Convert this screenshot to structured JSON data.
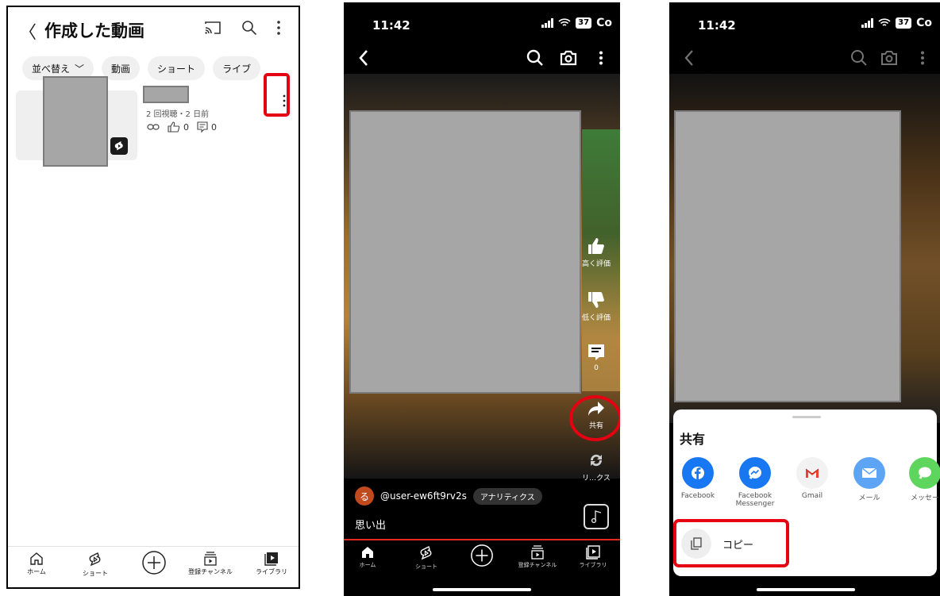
{
  "panel1": {
    "header": {
      "back": "〈",
      "title": "作成した動画"
    },
    "chips": [
      "並べ替え",
      "動画",
      "ショート",
      "ライブ"
    ],
    "video": {
      "stats": "2 回視聴・2 日前",
      "likes": "0",
      "comments": "0"
    },
    "nav": [
      "ホーム",
      "ショート",
      "",
      "登録チャンネル",
      "ライブラリ"
    ]
  },
  "panel2": {
    "status": {
      "time": "11:42",
      "battery": "37",
      "carrier": "Co"
    },
    "actions": {
      "like": "高く評価",
      "dislike": "低く評価",
      "comments_count": "0",
      "share": "共有",
      "remix": "リ…クス"
    },
    "user": {
      "avatar_char": "る",
      "handle": "@user-ew6ft9rv2s",
      "analytics": "アナリティクス"
    },
    "caption": "思い出",
    "nav": [
      "ホーム",
      "ショート",
      "",
      "登録チャンネル",
      "ライブラリ"
    ]
  },
  "panel3": {
    "status": {
      "time": "11:42",
      "battery": "37",
      "carrier": "Co"
    },
    "sheet": {
      "title": "共有",
      "options": [
        {
          "label": "Facebook",
          "color": "#1877f2"
        },
        {
          "label": "Facebook\nMessenger",
          "color": "#1778f2"
        },
        {
          "label": "Gmail",
          "color": "#f2f2f2"
        },
        {
          "label": "メール",
          "color": "#5ea4f5"
        },
        {
          "label": "メッセー",
          "color": "#5ed65e"
        }
      ],
      "copy": "コピー"
    }
  },
  "colors": {
    "highlight": "#e50012",
    "shorts_red": "#e0281f"
  }
}
